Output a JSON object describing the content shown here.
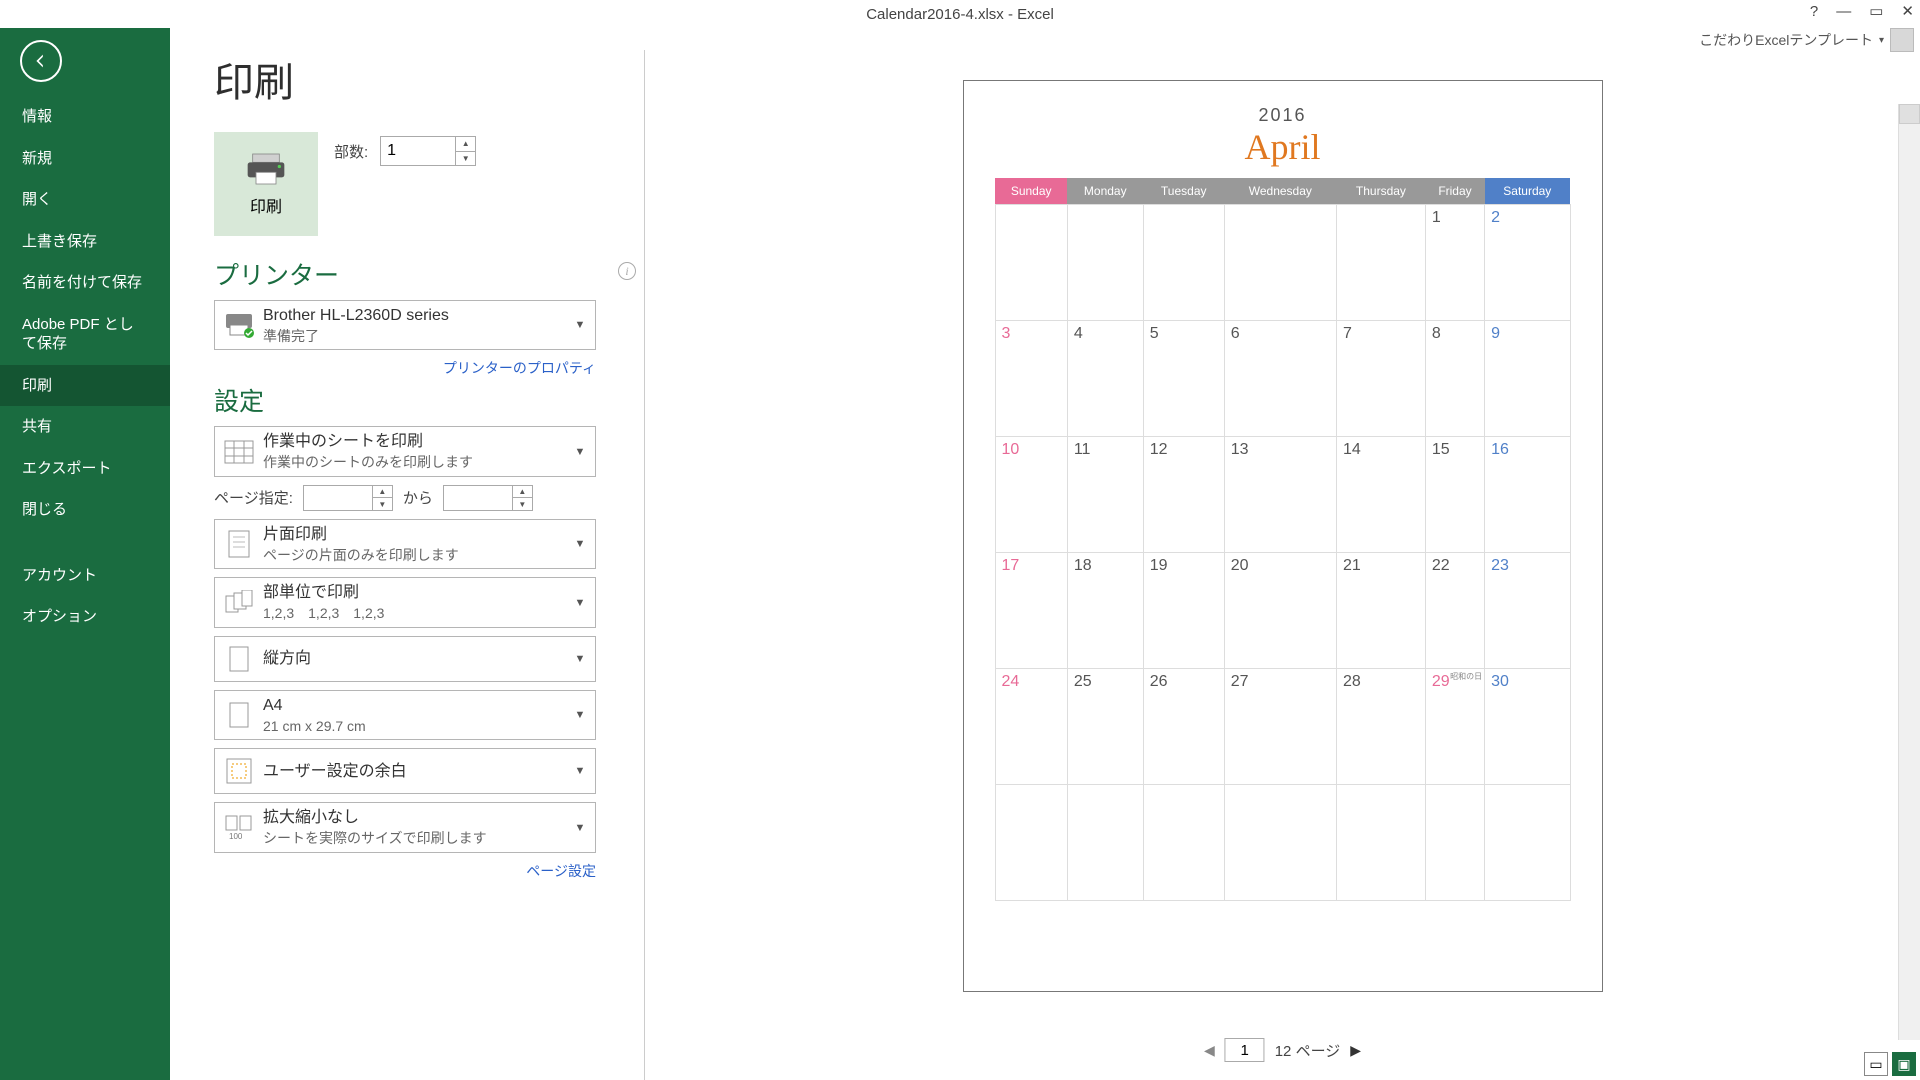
{
  "title": "Calendar2016-4.xlsx - Excel",
  "user_label": "こだわりExcelテンプレート",
  "sidebar": {
    "items": [
      "情報",
      "新規",
      "開く",
      "上書き保存",
      "名前を付けて保存",
      "Adobe PDF として保存",
      "印刷",
      "共有",
      "エクスポート",
      "閉じる"
    ],
    "bottom_items": [
      "アカウント",
      "オプション"
    ],
    "selected": 6
  },
  "page_title": "印刷",
  "print_button": "印刷",
  "copies_label": "部数:",
  "copies_value": "1",
  "printer_header": "プリンター",
  "printer": {
    "name": "Brother HL-L2360D series",
    "status": "準備完了"
  },
  "printer_props": "プリンターのプロパティ",
  "settings_header": "設定",
  "settings": {
    "print_what": {
      "t1": "作業中のシートを印刷",
      "t2": "作業中のシートのみを印刷します"
    },
    "page_range_label": "ページ指定:",
    "page_range_from": "",
    "page_range_sep": "から",
    "page_range_to": "",
    "duplex": {
      "t1": "片面印刷",
      "t2": "ページの片面のみを印刷します"
    },
    "collate": {
      "t1": "部単位で印刷",
      "t2": "1,2,3　1,2,3　1,2,3"
    },
    "orient": {
      "t1": "縦方向"
    },
    "paper": {
      "t1": "A4",
      "t2": "21 cm x 29.7 cm"
    },
    "margins": {
      "t1": "ユーザー設定の余白"
    },
    "scaling": {
      "t1": "拡大縮小なし",
      "t2": "シートを実際のサイズで印刷します"
    }
  },
  "page_setup_link": "ページ設定",
  "preview": {
    "year": "2016",
    "month": "April",
    "days": [
      "Sunday",
      "Monday",
      "Tuesday",
      "Wednesday",
      "Thursday",
      "Friday",
      "Saturday"
    ],
    "weeks": [
      [
        {
          "n": ""
        },
        {
          "n": ""
        },
        {
          "n": ""
        },
        {
          "n": ""
        },
        {
          "n": ""
        },
        {
          "n": "1",
          "c": "wd"
        },
        {
          "n": "2",
          "c": "sat"
        }
      ],
      [
        {
          "n": "3",
          "c": "sun"
        },
        {
          "n": "4",
          "c": "wd"
        },
        {
          "n": "5",
          "c": "wd"
        },
        {
          "n": "6",
          "c": "wd"
        },
        {
          "n": "7",
          "c": "wd"
        },
        {
          "n": "8",
          "c": "wd"
        },
        {
          "n": "9",
          "c": "sat"
        }
      ],
      [
        {
          "n": "10",
          "c": "sun"
        },
        {
          "n": "11",
          "c": "wd"
        },
        {
          "n": "12",
          "c": "wd"
        },
        {
          "n": "13",
          "c": "wd"
        },
        {
          "n": "14",
          "c": "wd"
        },
        {
          "n": "15",
          "c": "wd"
        },
        {
          "n": "16",
          "c": "sat"
        }
      ],
      [
        {
          "n": "17",
          "c": "sun"
        },
        {
          "n": "18",
          "c": "wd"
        },
        {
          "n": "19",
          "c": "wd"
        },
        {
          "n": "20",
          "c": "wd"
        },
        {
          "n": "21",
          "c": "wd"
        },
        {
          "n": "22",
          "c": "wd"
        },
        {
          "n": "23",
          "c": "sat"
        }
      ],
      [
        {
          "n": "24",
          "c": "sun"
        },
        {
          "n": "25",
          "c": "wd"
        },
        {
          "n": "26",
          "c": "wd"
        },
        {
          "n": "27",
          "c": "wd"
        },
        {
          "n": "28",
          "c": "wd"
        },
        {
          "n": "29",
          "c": "hol",
          "note": "昭和の日"
        },
        {
          "n": "30",
          "c": "sat"
        }
      ],
      [
        {
          "n": ""
        },
        {
          "n": ""
        },
        {
          "n": ""
        },
        {
          "n": ""
        },
        {
          "n": ""
        },
        {
          "n": ""
        },
        {
          "n": ""
        }
      ]
    ]
  },
  "pager": {
    "current": "1",
    "total_label": "12 ページ"
  }
}
